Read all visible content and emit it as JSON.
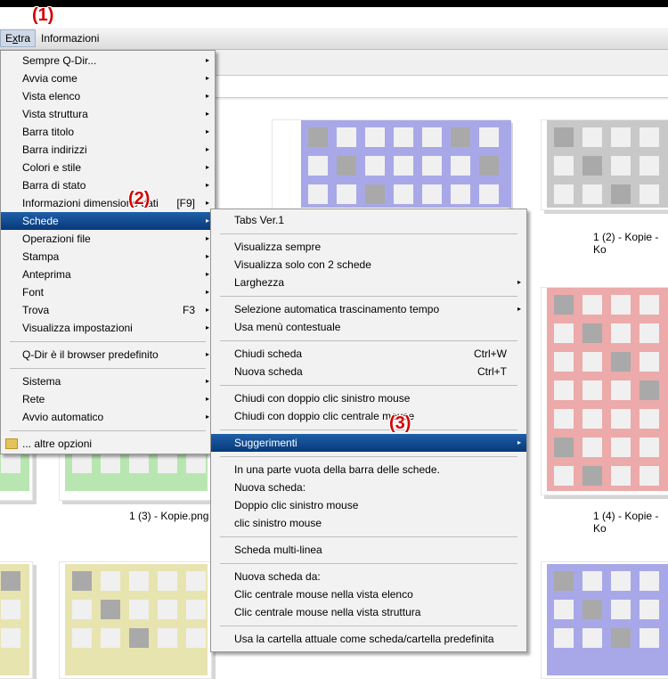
{
  "annotations": {
    "a1": "(1)",
    "a2": "(2)",
    "a3": "(3)"
  },
  "menubar": {
    "extra": "Extra",
    "extra_accel": "x",
    "info": "Informazioni"
  },
  "captions": {
    "c1": "1 (2) - Kopie - Ko",
    "c2": "1 (3) - Kopie.png",
    "c3": "1 (4) - Kopie - Ko"
  },
  "colors": {
    "purple": "#a8a8e8",
    "gray": "#c8c8c8",
    "green": "#b8e6b0",
    "red": "#ecaaaa",
    "yellow": "#e8e4b0",
    "selected": "#0a3d7c"
  },
  "main_menu": {
    "items": [
      {
        "label": "Sempre Q-Dir...",
        "arrow": "▸"
      },
      {
        "label": "Avvia come",
        "arrow": "▸"
      },
      {
        "label": "Vista elenco",
        "arrow": "▸"
      },
      {
        "label": "Vista struttura",
        "arrow": "▸"
      },
      {
        "label": "Barra titolo",
        "arrow": "▸"
      },
      {
        "label": "Barra indirizzi",
        "arrow": "▸"
      },
      {
        "label": "Colori e stile",
        "arrow": "▸"
      },
      {
        "label": "Barra di stato",
        "arrow": "▸"
      },
      {
        "label": "Informazioni dimensione dati",
        "shortcut": "[F9]",
        "arrow": "▸"
      },
      {
        "label": "Schede",
        "arrow": "▸"
      },
      {
        "label": "Operazioni file",
        "arrow": "▸"
      },
      {
        "label": "Stampa",
        "arrow": "▸"
      },
      {
        "label": "Anteprima",
        "arrow": "▸"
      },
      {
        "label": "Font",
        "arrow": "▸"
      },
      {
        "label": "Trova",
        "shortcut": "F3",
        "arrow": "▸"
      },
      {
        "label": "Visualizza impostazioni",
        "arrow": "▸"
      },
      {
        "label": "Q-Dir è il browser predefinito",
        "arrow": "▸"
      },
      {
        "label": "Sistema",
        "arrow": "▸"
      },
      {
        "label": "Rete",
        "arrow": "▸"
      },
      {
        "label": "Avvio automatico",
        "arrow": "▸"
      },
      {
        "label": "... altre opzioni"
      }
    ]
  },
  "sub_menu": {
    "items": [
      {
        "label": "Tabs Ver.1"
      },
      {
        "label": "Visualizza sempre"
      },
      {
        "label": "Visualizza solo con 2 schede"
      },
      {
        "label": "Larghezza",
        "arrow": "▸"
      },
      {
        "label": "Selezione automatica trascinamento tempo",
        "arrow": "▸"
      },
      {
        "label": "Usa menù contestuale"
      },
      {
        "label": "Chiudi scheda",
        "shortcut": "Ctrl+W"
      },
      {
        "label": "Nuova scheda",
        "shortcut": "Ctrl+T"
      },
      {
        "label": "Chiudi con doppio clic sinistro mouse"
      },
      {
        "label": "Chiudi con doppio clic centrale mouse"
      },
      {
        "label": "Suggerimenti",
        "arrow": "▸"
      },
      {
        "label": "In una parte vuota della barra delle schede."
      },
      {
        "label": "Nuova scheda:"
      },
      {
        "label": "Doppio clic sinistro mouse"
      },
      {
        "label": "clic sinistro mouse"
      },
      {
        "label": "Scheda multi-linea"
      },
      {
        "label": "Nuova scheda da:"
      },
      {
        "label": "Clic centrale mouse nella vista elenco"
      },
      {
        "label": "Clic centrale mouse nella vista struttura"
      },
      {
        "label": "Usa la cartella attuale come scheda/cartella predefinita"
      }
    ]
  }
}
